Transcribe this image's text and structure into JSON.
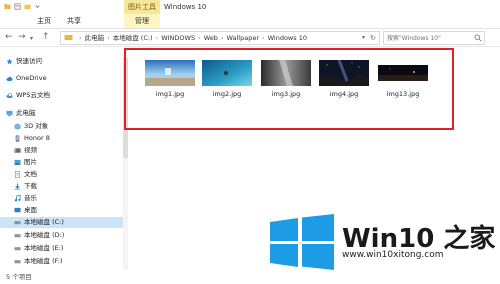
{
  "window": {
    "title": "Windows 10",
    "tool_tab": "图片工具"
  },
  "ribbon": {
    "tabs": [
      "文件",
      "主页",
      "共享",
      "管理"
    ]
  },
  "address": {
    "crumbs": [
      "此电脑",
      "本地磁盘 (C:)",
      "WINDOWS",
      "Web",
      "Wallpaper",
      "Windows 10"
    ]
  },
  "search": {
    "placeholder": "搜索\"Windows 10\""
  },
  "sidebar": {
    "items": [
      {
        "label": "快速访问",
        "icon": "star-icon"
      },
      {
        "label": "OneDrive",
        "icon": "cloud-icon"
      },
      {
        "label": "WPS云文档",
        "icon": "cloud-doc-icon"
      },
      {
        "label": "此电脑",
        "icon": "computer-icon"
      },
      {
        "label": "3D 对象",
        "icon": "cube-icon"
      },
      {
        "label": "Honor 8",
        "icon": "phone-icon"
      },
      {
        "label": "视频",
        "icon": "video-icon"
      },
      {
        "label": "图片",
        "icon": "picture-icon"
      },
      {
        "label": "文档",
        "icon": "document-icon"
      },
      {
        "label": "下载",
        "icon": "download-icon"
      },
      {
        "label": "音乐",
        "icon": "music-icon"
      },
      {
        "label": "桌面",
        "icon": "desktop-icon"
      },
      {
        "label": "本地磁盘 (C:)",
        "icon": "drive-icon"
      },
      {
        "label": "本地磁盘 (D:)",
        "icon": "drive-icon"
      },
      {
        "label": "本地磁盘 (E:)",
        "icon": "drive-icon"
      },
      {
        "label": "本地磁盘 (F:)",
        "icon": "drive-icon"
      }
    ]
  },
  "files": [
    {
      "name": "img1.jpg"
    },
    {
      "name": "img2.jpg"
    },
    {
      "name": "img3.jpg"
    },
    {
      "name": "img4.jpg"
    },
    {
      "name": "img13.jpg"
    }
  ],
  "status": {
    "count": "5 个项目"
  },
  "watermark": {
    "title": "Win10 之家",
    "url": "www.win10xitong.com"
  },
  "colors": {
    "accent": "#1a74d2",
    "highlight_box": "#e0202a",
    "logo_blue": "#1e9be5"
  }
}
